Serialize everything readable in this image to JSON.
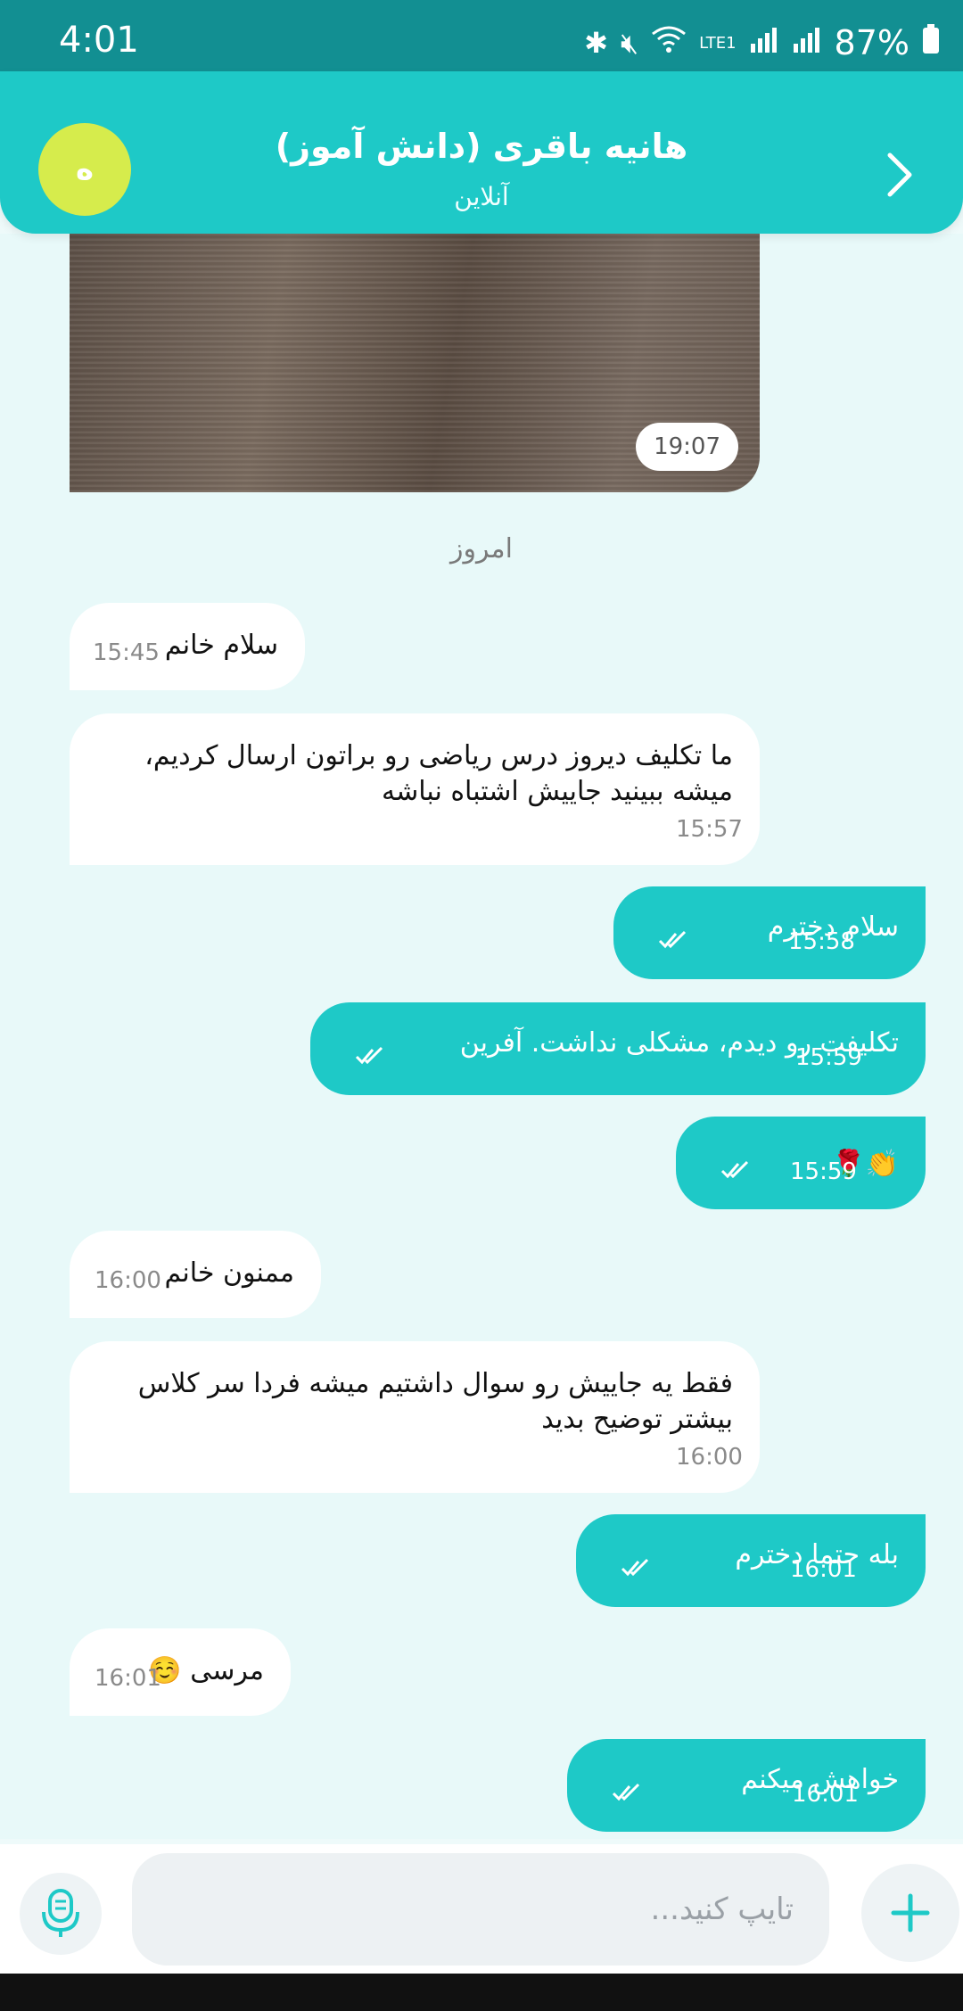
{
  "status_bar": {
    "time": "4:01",
    "battery": "87%",
    "network": "LTE1"
  },
  "header": {
    "avatar_text": "ه",
    "title": "هانیه باقری (دانش آموز)",
    "subtitle": "آنلاین"
  },
  "image_message": {
    "time": "19:07"
  },
  "day_separator": "امروز",
  "messages": [
    {
      "dir": "in",
      "text": "سلام خانم",
      "time": "15:45"
    },
    {
      "dir": "in",
      "text": "ما تکلیف دیروز درس ریاضی رو براتون ارسال کردیم، میشه ببینید جاییش اشتباه نباشه",
      "time": "15:57"
    },
    {
      "dir": "out",
      "text": "سلام دخترم",
      "time": "15:58"
    },
    {
      "dir": "out",
      "text": "تکلیفت رو دیدم، مشکلی نداشت. آفرین",
      "time": "15:59"
    },
    {
      "dir": "out",
      "text": "👏🌹",
      "time": "15:59"
    },
    {
      "dir": "in",
      "text": "ممنون خانم",
      "time": "16:00"
    },
    {
      "dir": "in",
      "text": "فقط یه جاییش رو سوال داشتیم میشه فردا سر کلاس بیشتر توضیح بدید",
      "time": "16:00"
    },
    {
      "dir": "out",
      "text": "بله حتما دخترم",
      "time": "16:01"
    },
    {
      "dir": "in",
      "text": "مرسی ☺️",
      "time": "16:01"
    },
    {
      "dir": "out",
      "text": "خواهش میکنم",
      "time": "16:01"
    }
  ],
  "composer": {
    "placeholder": "تایپ کنید..."
  },
  "colors": {
    "accent": "#1ec9c7",
    "status_bar": "#128f92",
    "avatar": "#d6ec4c"
  }
}
